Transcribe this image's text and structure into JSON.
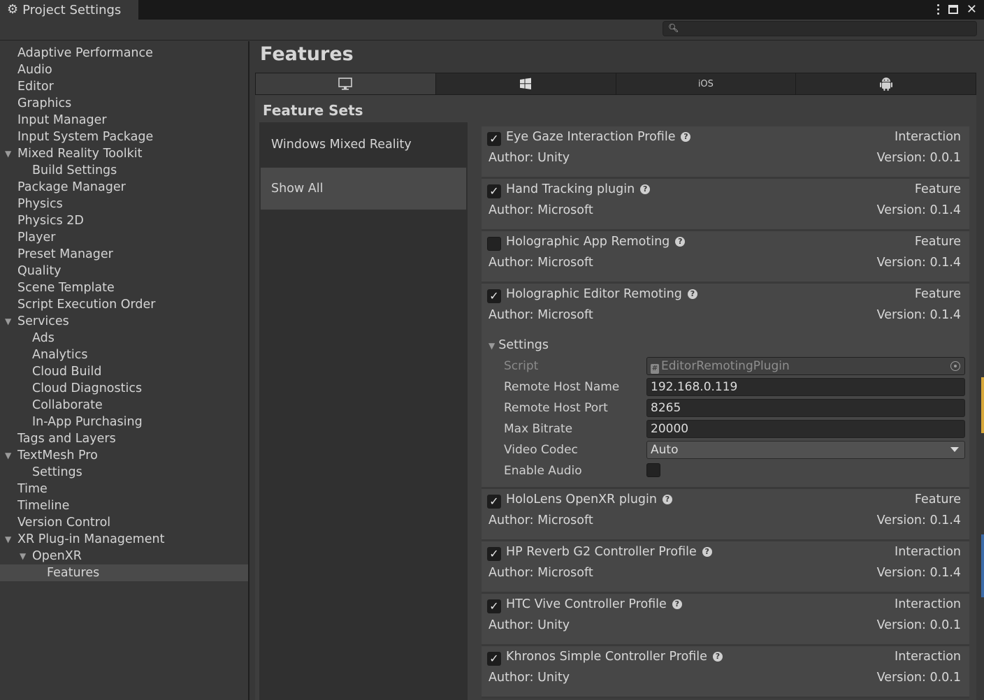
{
  "window": {
    "title": "Project Settings",
    "controls": [
      "more-menu",
      "maximize",
      "close"
    ]
  },
  "search": {
    "placeholder": ""
  },
  "sidebar": {
    "items": [
      {
        "label": "Adaptive Performance",
        "level": 0
      },
      {
        "label": "Audio",
        "level": 0
      },
      {
        "label": "Editor",
        "level": 0
      },
      {
        "label": "Graphics",
        "level": 0
      },
      {
        "label": "Input Manager",
        "level": 0
      },
      {
        "label": "Input System Package",
        "level": 0
      },
      {
        "label": "Mixed Reality Toolkit",
        "level": 0,
        "expanded": true
      },
      {
        "label": "Build Settings",
        "level": 1
      },
      {
        "label": "Package Manager",
        "level": 0
      },
      {
        "label": "Physics",
        "level": 0
      },
      {
        "label": "Physics 2D",
        "level": 0
      },
      {
        "label": "Player",
        "level": 0
      },
      {
        "label": "Preset Manager",
        "level": 0
      },
      {
        "label": "Quality",
        "level": 0
      },
      {
        "label": "Scene Template",
        "level": 0
      },
      {
        "label": "Script Execution Order",
        "level": 0
      },
      {
        "label": "Services",
        "level": 0,
        "expanded": true
      },
      {
        "label": "Ads",
        "level": 1
      },
      {
        "label": "Analytics",
        "level": 1
      },
      {
        "label": "Cloud Build",
        "level": 1
      },
      {
        "label": "Cloud Diagnostics",
        "level": 1
      },
      {
        "label": "Collaborate",
        "level": 1
      },
      {
        "label": "In-App Purchasing",
        "level": 1
      },
      {
        "label": "Tags and Layers",
        "level": 0
      },
      {
        "label": "TextMesh Pro",
        "level": 0,
        "expanded": true
      },
      {
        "label": "Settings",
        "level": 1
      },
      {
        "label": "Time",
        "level": 0
      },
      {
        "label": "Timeline",
        "level": 0
      },
      {
        "label": "Version Control",
        "level": 0
      },
      {
        "label": "XR Plug-in Management",
        "level": 0,
        "expanded": true
      },
      {
        "label": "OpenXR",
        "level": 1,
        "expanded": true
      },
      {
        "label": "Features",
        "level": 2,
        "selected": true
      }
    ]
  },
  "main": {
    "title": "Features",
    "platform_tabs": [
      {
        "icon": "desktop-icon",
        "label": "",
        "active": true
      },
      {
        "icon": "windows-icon",
        "label": ""
      },
      {
        "icon": "",
        "label": "iOS"
      },
      {
        "icon": "android-icon",
        "label": ""
      }
    ],
    "feature_sets_title": "Feature Sets",
    "feature_sets": [
      {
        "label": "Windows Mixed Reality"
      },
      {
        "label": "Show All",
        "selected": true
      }
    ],
    "features": [
      {
        "name": "Eye Gaze Interaction Profile",
        "enabled": true,
        "type": "Interaction",
        "author": "Author: Unity",
        "version": "Version: 0.0.1"
      },
      {
        "name": "Hand Tracking plugin",
        "enabled": true,
        "type": "Feature",
        "author": "Author: Microsoft",
        "version": "Version: 0.1.4"
      },
      {
        "name": "Holographic App Remoting",
        "enabled": false,
        "type": "Feature",
        "author": "Author: Microsoft",
        "version": "Version: 0.1.4"
      },
      {
        "name": "Holographic Editor Remoting",
        "enabled": true,
        "type": "Feature",
        "author": "Author: Microsoft",
        "version": "Version: 0.1.4"
      },
      {
        "name": "HoloLens OpenXR plugin",
        "enabled": true,
        "type": "Feature",
        "author": "Author: Microsoft",
        "version": "Version: 0.1.4"
      },
      {
        "name": "HP Reverb G2 Controller Profile",
        "enabled": true,
        "type": "Interaction",
        "author": "Author: Microsoft",
        "version": "Version: 0.1.4"
      },
      {
        "name": "HTC Vive Controller Profile",
        "enabled": true,
        "type": "Interaction",
        "author": "Author: Unity",
        "version": "Version: 0.0.1"
      },
      {
        "name": "Khronos Simple Controller Profile",
        "enabled": true,
        "type": "Interaction",
        "author": "Author: Unity",
        "version": "Version: 0.0.1"
      }
    ],
    "remoting_settings": {
      "header": "Settings",
      "script_label": "Script",
      "script_value": "EditorRemotingPlugin",
      "host_name_label": "Remote Host Name",
      "host_name_value": "192.168.0.119",
      "host_port_label": "Remote Host Port",
      "host_port_value": "8265",
      "bitrate_label": "Max Bitrate",
      "bitrate_value": "20000",
      "codec_label": "Video Codec",
      "codec_value": "Auto",
      "audio_label": "Enable Audio",
      "audio_enabled": false
    }
  }
}
